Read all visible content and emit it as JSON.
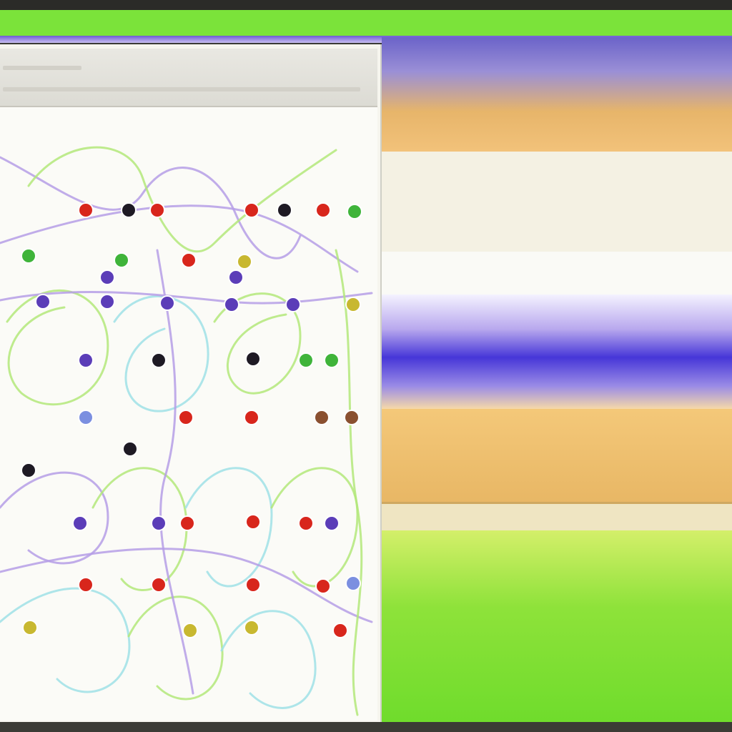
{
  "window": {
    "title": ""
  },
  "graph": {
    "toolbar_text": "",
    "edge_colors": [
      "#b59ee6",
      "#b3e87a",
      "#9fe0e6"
    ],
    "node_colors": {
      "red": "#d8261c",
      "dark": "#1e1a24",
      "purple": "#5b3db8",
      "blue": "#7b8fe0",
      "green": "#3fb43a",
      "olive": "#c8b830",
      "brown": "#8a5030"
    }
  },
  "preview": {
    "colors": {
      "top": "#6b63c9",
      "amber": "#f2c27a",
      "violet": "#4636d8",
      "green": "#6fdc2c"
    }
  }
}
